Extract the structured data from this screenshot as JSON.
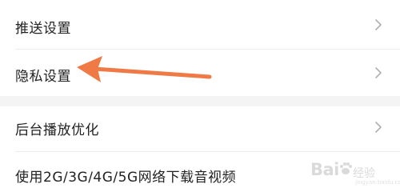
{
  "settings": {
    "section1": [
      {
        "label": "推送设置",
        "has_chevron": true
      },
      {
        "label": "隐私设置",
        "has_chevron": true
      }
    ],
    "section2": [
      {
        "label": "后台播放优化",
        "has_chevron": true
      },
      {
        "label": "使用2G/3G/4G/5G网络下载音视频",
        "has_chevron": false
      }
    ]
  },
  "annotation": {
    "arrow_color": "#f07a45",
    "points_to": "隐私设置"
  },
  "watermark": {
    "brand": "Bai",
    "brand_rest": "经验",
    "sub": "jingyan.baidu.com"
  },
  "colors": {
    "background": "#ffffff",
    "section_gap": "#f4f4f4",
    "divider": "#ececec",
    "text": "#222222",
    "chevron": "#b0b0b0"
  }
}
